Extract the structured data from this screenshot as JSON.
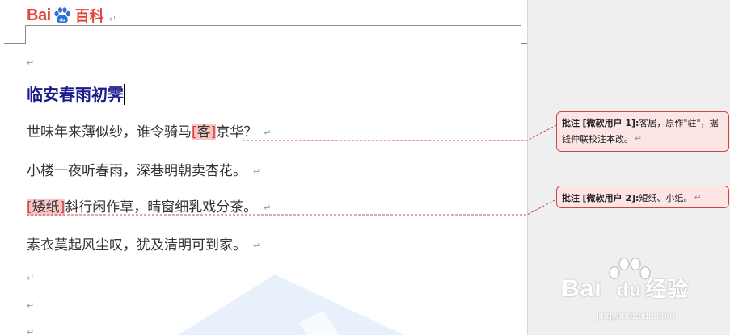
{
  "header": {
    "logo_bai": "Bai",
    "logo_du": "du",
    "logo_baike": "百科",
    "para_mark": "↵"
  },
  "document": {
    "title": "临安春雨初霁",
    "lines": [
      {
        "pre": "世味年来薄似纱，谁令骑马",
        "hl": "客",
        "post": "京华？"
      },
      {
        "pre": "小楼一夜听春雨，深巷明朝卖杏花。",
        "hl": "",
        "post": ""
      },
      {
        "pre": "",
        "hl": "矮纸",
        "post": "斜行闲作草，晴窗细乳戏分茶。"
      },
      {
        "pre": "素衣莫起风尘叹，犹及清明可到家。",
        "hl": "",
        "post": ""
      }
    ],
    "para_mark": "↵"
  },
  "comments": [
    {
      "label": "批注",
      "author": "[微软用户 1]:",
      "text": "客居，原作\"驻\"，据钱仲联校注本改。",
      "mark": "↵"
    },
    {
      "label": "批注",
      "author": "[微软用户 2]:",
      "text": "短纸、小纸。",
      "mark": "↵"
    }
  ],
  "watermark": {
    "brand": "Bai",
    "brand2": "du",
    "brand3": "经验",
    "url": "jingyan.baidu.com"
  },
  "colors": {
    "title": "#1b1b8e",
    "highlight": "#f8c5c5",
    "comment_border": "#c84848",
    "comment_bg": "#fde5e5",
    "logo": "#e5453b"
  }
}
